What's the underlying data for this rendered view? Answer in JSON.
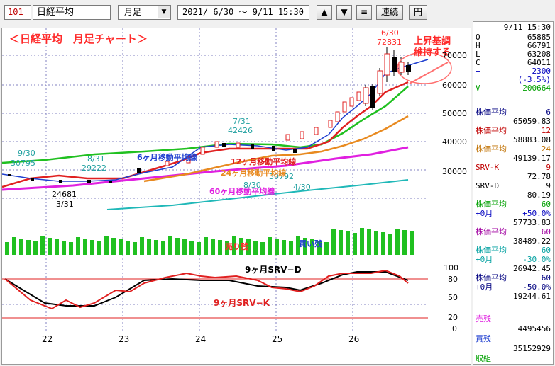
{
  "toolbar": {
    "code": "101",
    "name": "日経平均",
    "period": "月足",
    "range": "2021/ 6/30 ～ 9/11 15:30",
    "up_button": "▲",
    "down_button": "▼",
    "menu_button": "≡",
    "renzoku_button": "連続",
    "circle_button": "円"
  },
  "chart": {
    "title": "＜日経平均　月足チャート＞",
    "annotation": "上昇基調\n維持する",
    "ma_labels": {
      "m6": "6ヶ月移動平均線",
      "m12": "12ヶ月移動平均線",
      "m24": "24ヶ月移動平均線",
      "m60": "60ヶ月移動平均線"
    },
    "price_axis": [
      "70000",
      "60000",
      "50000",
      "40000",
      "30000"
    ],
    "lower_axis": [
      "100",
      "80",
      "50",
      "20",
      "0"
    ],
    "x_axis": [
      "22",
      "23",
      "24",
      "25",
      "26"
    ],
    "price_labels": {
      "sep": "9/30",
      "sep_val": "30795",
      "mar": "24681",
      "mar_d": "3/31",
      "aug": "8/31",
      "aug_val": "29222",
      "jul": "7/31",
      "jul_val": "42426",
      "apr_d": "8/30",
      "apr_val": "30792",
      "apr_d2": "4/30",
      "jun": "6/30",
      "jun_val": "72831"
    },
    "volume_labels": {
      "sell": "売り残",
      "buy": "買い残"
    },
    "srv_labels": {
      "d": "9ヶ月SRV−D",
      "k": "9ヶ月SRV−K"
    },
    "colors": {
      "ma6": "#1f3fd0",
      "ma12": "#e0201a",
      "ma24": "#e88a20",
      "ma60": "#e020e0",
      "ma120": "#20b8b8",
      "green": "#20c020",
      "red": "#e02020",
      "title": "#ff2a2a"
    }
  },
  "panel": {
    "date": "9/11 15:30",
    "ohlc": [
      {
        "l": "O",
        "v": "65885"
      },
      {
        "l": "H",
        "v": "66791"
      },
      {
        "l": "L",
        "v": "63208"
      },
      {
        "l": "C",
        "v": "64011"
      }
    ],
    "change": "2300",
    "change_pct": "(-3.5%)",
    "volume_label": "V",
    "volume": "200664",
    "items": [
      {
        "l": "株価平均",
        "n": "6",
        "v": "65059.83",
        "c": "#000080"
      },
      {
        "l": "株価平均",
        "n": "12",
        "v": "58883.08",
        "c": "#c00000"
      },
      {
        "l": "株価平均",
        "n": "24",
        "v": "49139.17",
        "c": "#c07000"
      },
      {
        "l": "SRV-K",
        "n": "9",
        "v": "72.78",
        "c": "#c00000"
      },
      {
        "l": "SRV-D",
        "n": "9",
        "v": "80.19",
        "c": "#000000"
      },
      {
        "l": "株価平均",
        "n": "60",
        "v": "",
        "c": "#00a000"
      },
      {
        "l": "+0月",
        "n": "+50.0%",
        "v": "57733.83",
        "c": "#0000c0"
      },
      {
        "l": "株価平均",
        "n": "60",
        "v": "38489.22",
        "c": "#a000a0"
      },
      {
        "l": "株価平均",
        "n": "60",
        "v": "",
        "c": "#00a0a0"
      },
      {
        "l": "+0月",
        "n": "-30.0%",
        "v": "26942.45",
        "c": "#00a0a0"
      },
      {
        "l": "株価平均",
        "n": "60",
        "v": "",
        "c": "#000080"
      },
      {
        "l": "+0月",
        "n": "-50.0%",
        "v": "19244.61",
        "c": "#000080"
      }
    ],
    "sell_label": "売残",
    "sell": "4495456",
    "buy_label": "買残",
    "buy": "35152929",
    "torikumi": "取組"
  }
}
